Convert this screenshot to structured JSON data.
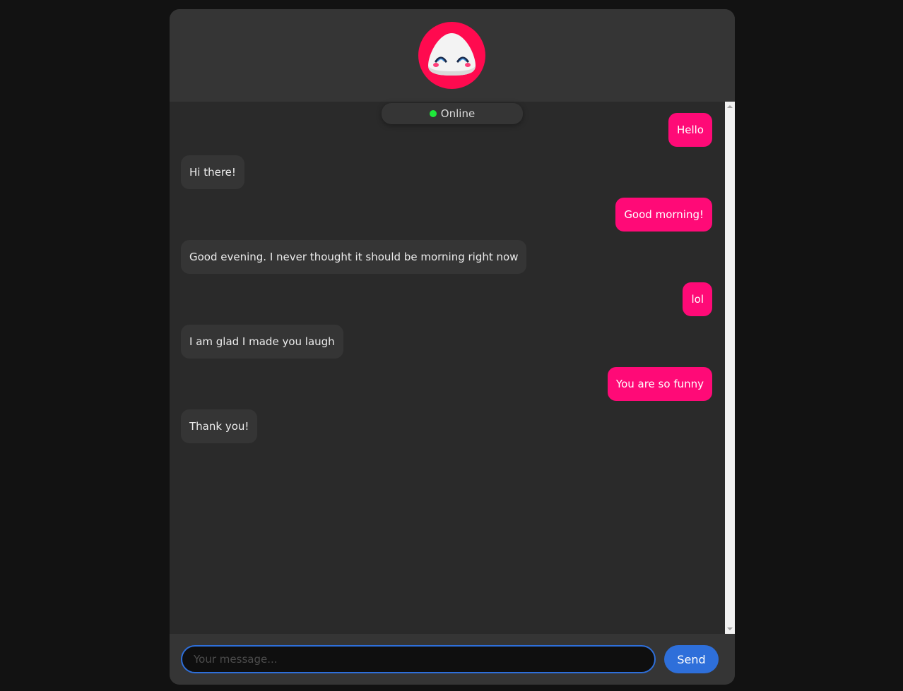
{
  "status": {
    "label": "Online",
    "color": "#1ee83a"
  },
  "avatar": {
    "icon": "smiling-blob-mascot-icon",
    "color": "#ff0a4f"
  },
  "messages": [
    {
      "from": "user",
      "text": "Hello"
    },
    {
      "from": "bot",
      "text": "Hi there!"
    },
    {
      "from": "user",
      "text": "Good morning!"
    },
    {
      "from": "bot",
      "text": "Good evening. I never thought it should be morning right now"
    },
    {
      "from": "user",
      "text": "lol"
    },
    {
      "from": "bot",
      "text": "I am glad I made you laugh"
    },
    {
      "from": "user",
      "text": "You are so funny"
    },
    {
      "from": "bot",
      "text": "Thank you!"
    }
  ],
  "composer": {
    "placeholder": "Your message...",
    "value": "",
    "send_label": "Send"
  },
  "colors": {
    "sent_bubble": "#ff0a77",
    "received_bubble": "#353535",
    "accent": "#2e6fda"
  }
}
